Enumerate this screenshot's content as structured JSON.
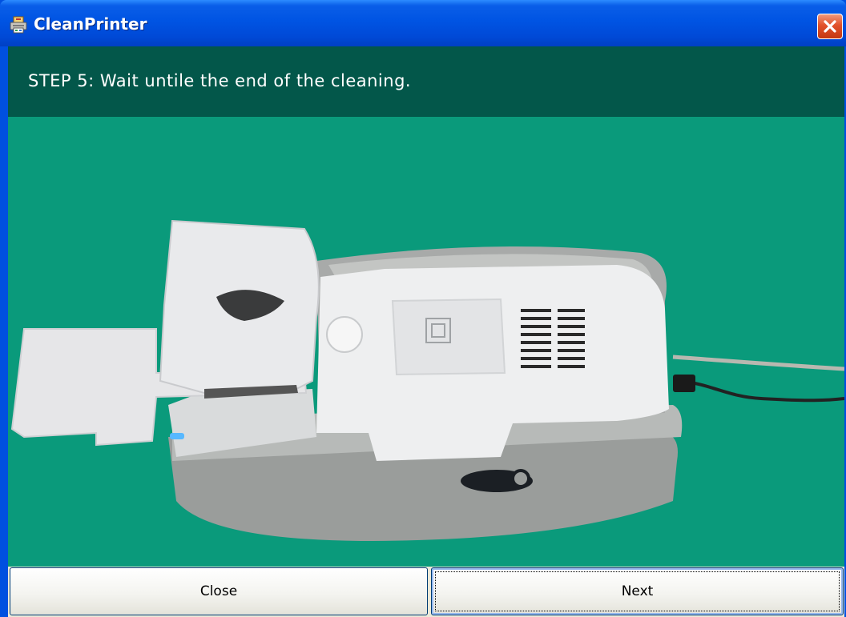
{
  "window": {
    "title": "CleanPrinter",
    "app_icon": "printer-app-icon",
    "close_icon": "close-x-icon"
  },
  "step": {
    "text": "STEP 5:  Wait untile the end of the cleaning."
  },
  "illustration": {
    "subject": "card-printer-photo"
  },
  "buttons": {
    "close_label": "Close",
    "next_label": "Next"
  },
  "colors": {
    "title_bar": "#0054e3",
    "header_band": "#03574a",
    "image_background": "#0a9a7b",
    "close_button": "#e2512a"
  }
}
